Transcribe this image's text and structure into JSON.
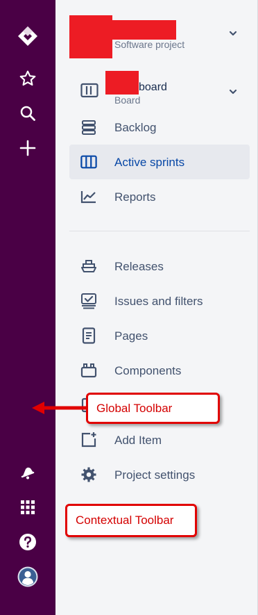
{
  "global_toolbar": {
    "icons": [
      "jira-logo-icon",
      "star-icon",
      "search-icon",
      "plus-icon",
      "notification-icon",
      "app-switcher-icon",
      "help-icon",
      "profile-avatar-icon"
    ],
    "background": "#4a0045"
  },
  "project": {
    "type": "Software project"
  },
  "board": {
    "name_suffix": "board",
    "type": "Board"
  },
  "nav": {
    "backlog": "Backlog",
    "active_sprints": "Active sprints",
    "reports": "Reports",
    "releases": "Releases",
    "issues_filters": "Issues and filters",
    "pages": "Pages",
    "components": "Components",
    "add_item": "Add Item",
    "project_settings": "Project settings"
  },
  "annotations": {
    "global_toolbar": "Global Toolbar",
    "contextual_toolbar": "Contextual Toolbar"
  },
  "colors": {
    "accent": "#0747a6",
    "redaction": "#ed1c24",
    "callout_red": "#d40000"
  }
}
